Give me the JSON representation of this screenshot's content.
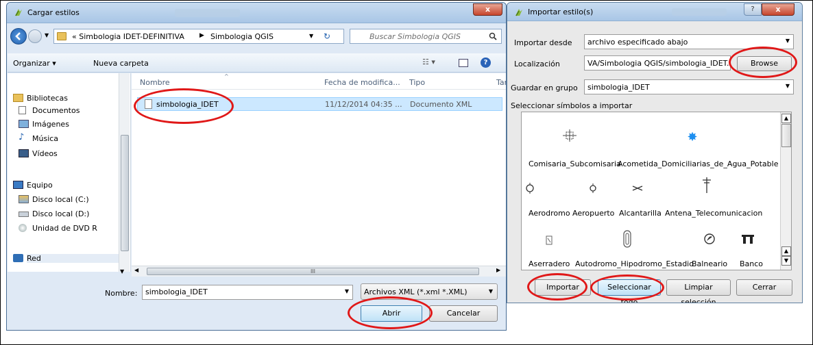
{
  "open_dialog": {
    "title": "Cargar estilos",
    "breadcrumb": [
      "« Simbologia IDET-DEFINITIVA",
      "Simbologia QGIS"
    ],
    "search_placeholder": "Buscar Simbologia QGIS",
    "toolbar": {
      "organize": "Organizar ▾",
      "new_folder": "Nueva carpeta"
    },
    "columns": [
      "Nombre",
      "Fecha de modifica...",
      "Tipo",
      "Tar"
    ],
    "nav": {
      "libraries": "Bibliotecas",
      "lib_items": [
        "Documentos",
        "Imágenes",
        "Música",
        "Vídeos"
      ],
      "computer": "Equipo",
      "comp_items": [
        "Disco local (C:)",
        "Disco local (D:)",
        "Unidad de DVD R"
      ],
      "network": "Red"
    },
    "files": [
      {
        "name": "simbologia_IDET",
        "date": "11/12/2014 04:35 ...",
        "type": "Documento XML"
      }
    ],
    "filename_label": "Nombre:",
    "filename_value": "simbologia_IDET",
    "filter": "Archivos XML (*.xml *.XML)",
    "open_label": "Abrir",
    "cancel_label": "Cancelar",
    "scroll_dots": "III"
  },
  "import_dialog": {
    "title": "Importar estilo(s)",
    "import_from_label": "Importar desde",
    "import_from_value": "archivo especificado abajo",
    "location_label": "Localización",
    "location_value": "VA/Simbologia QGIS/simbologia_IDET.xml",
    "browse_label": "Browse",
    "group_label": "Guardar en grupo",
    "group_value": "simbologia_IDET",
    "select_label": "Seleccionar símbolos a importar",
    "symbols_row1": [
      "Comisaria_Subcomisaria",
      "Acometida_Domiciliarias_de_Agua_Potable"
    ],
    "symbols_row2": [
      "Aerodromo",
      "Aeropuerto",
      "Alcantarilla",
      "Antena_Telecomunicacion"
    ],
    "symbols_row3": [
      "Aserradero",
      "Autodromo_Hipodromo_Estadio",
      "Balneario",
      "Banco"
    ],
    "import_button": "Importar",
    "select_all_button": "Seleccionar todo",
    "clear_button": "Limpiar selección",
    "close_button": "Cerrar"
  },
  "colors": {
    "accent": "#e01818",
    "selection": "#cce8ff",
    "titlebar": "#a9c6e6"
  }
}
